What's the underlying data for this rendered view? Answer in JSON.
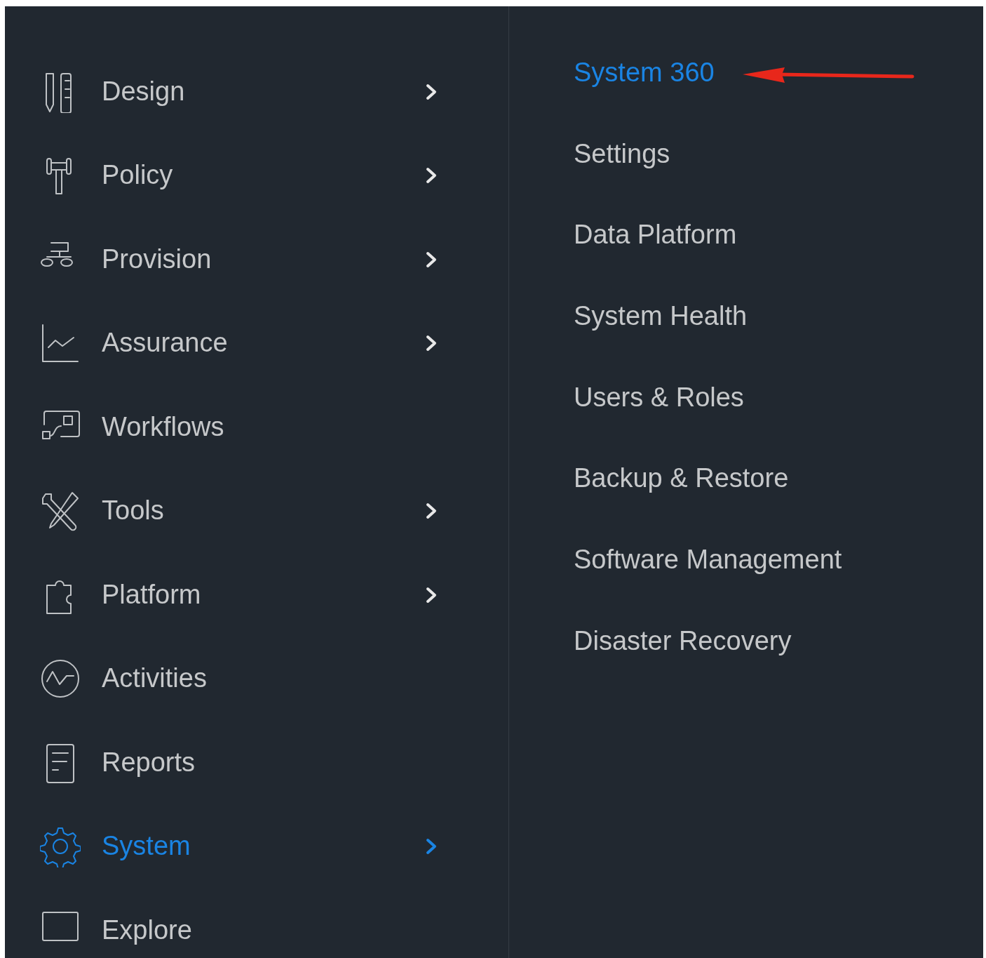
{
  "menu": {
    "items": [
      {
        "label": "Design",
        "has_submenu": true,
        "selected": false
      },
      {
        "label": "Policy",
        "has_submenu": true,
        "selected": false
      },
      {
        "label": "Provision",
        "has_submenu": true,
        "selected": false
      },
      {
        "label": "Assurance",
        "has_submenu": true,
        "selected": false
      },
      {
        "label": "Workflows",
        "has_submenu": false,
        "selected": false
      },
      {
        "label": "Tools",
        "has_submenu": true,
        "selected": false
      },
      {
        "label": "Platform",
        "has_submenu": true,
        "selected": false
      },
      {
        "label": "Activities",
        "has_submenu": false,
        "selected": false
      },
      {
        "label": "Reports",
        "has_submenu": false,
        "selected": false
      },
      {
        "label": "System",
        "has_submenu": true,
        "selected": true
      },
      {
        "label": "Explore",
        "has_submenu": false,
        "selected": false
      }
    ]
  },
  "submenu": {
    "items": [
      {
        "label": "System 360",
        "selected": true
      },
      {
        "label": "Settings",
        "selected": false
      },
      {
        "label": "Data Platform",
        "selected": false
      },
      {
        "label": "System Health",
        "selected": false
      },
      {
        "label": "Users & Roles",
        "selected": false
      },
      {
        "label": "Backup & Restore",
        "selected": false
      },
      {
        "label": "Software Management",
        "selected": false
      },
      {
        "label": "Disaster Recovery",
        "selected": false
      }
    ]
  }
}
